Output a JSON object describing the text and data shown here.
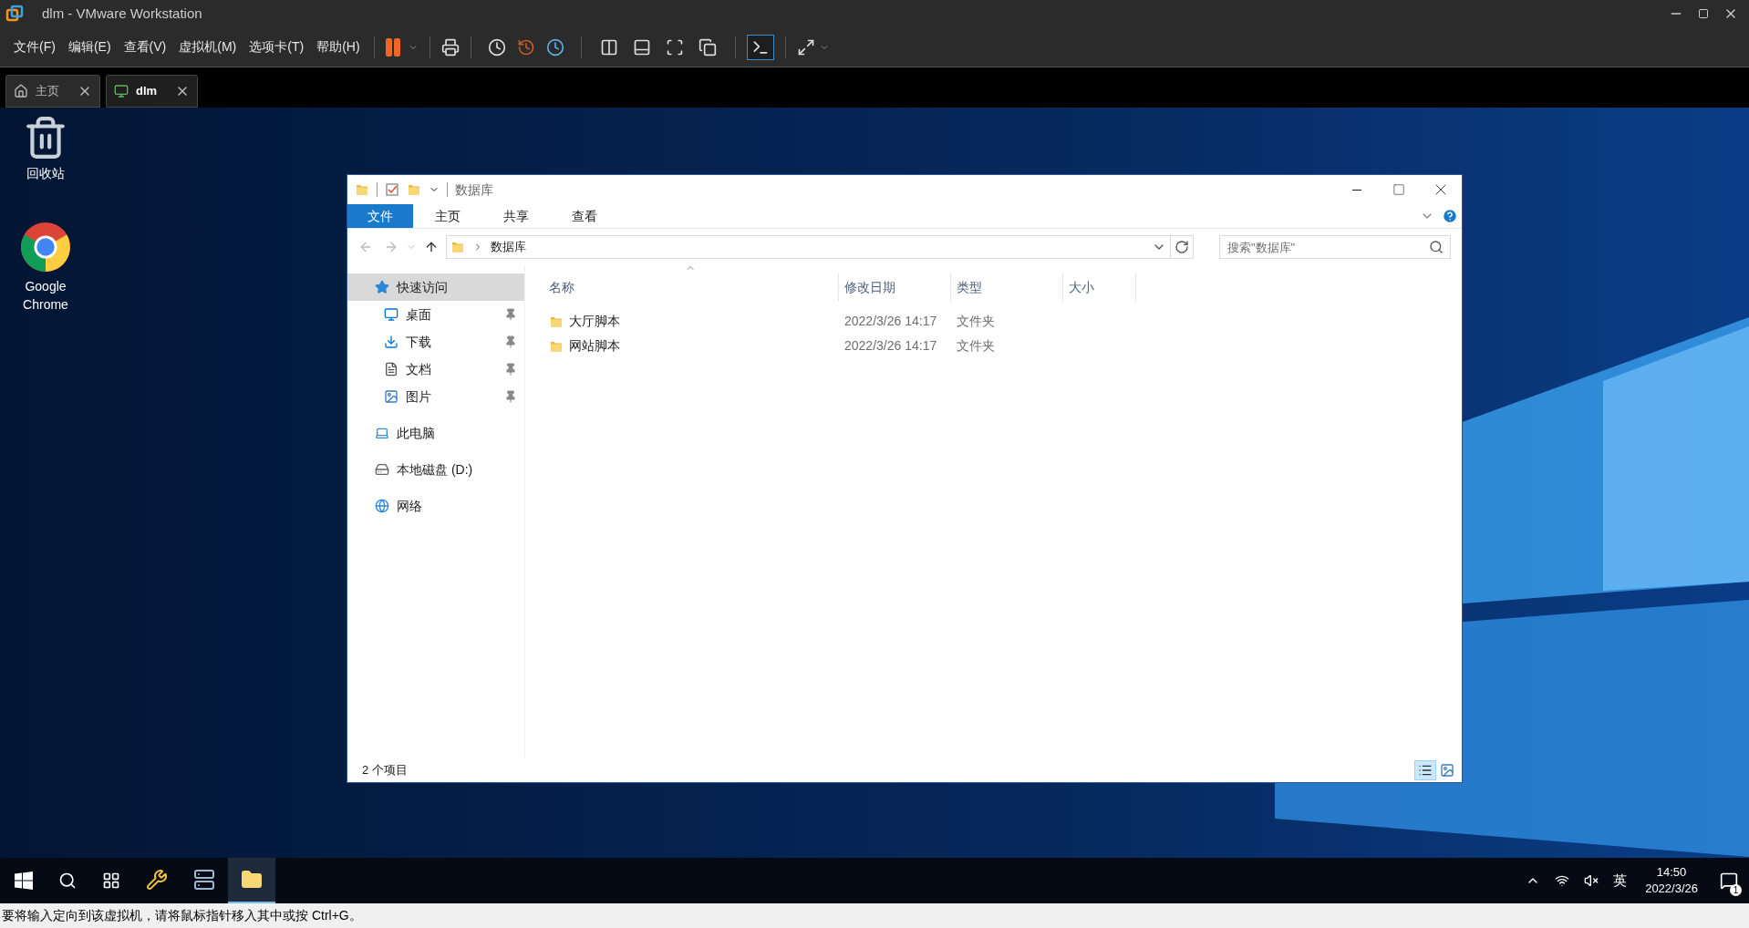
{
  "window": {
    "title": "dlm - VMware Workstation"
  },
  "menu": [
    "文件(F)",
    "编辑(E)",
    "查看(V)",
    "虚拟机(M)",
    "选项卡(T)",
    "帮助(H)"
  ],
  "vm_tabs": [
    {
      "label": "主页",
      "kind": "home",
      "selected": false
    },
    {
      "label": "dlm",
      "kind": "vm",
      "selected": true
    }
  ],
  "desktop_icons": [
    {
      "label": "回收站",
      "kind": "recycle"
    },
    {
      "label": "Google Chrome",
      "kind": "chrome"
    }
  ],
  "explorer": {
    "title": "数据库",
    "ribbon_tabs": [
      {
        "label": "文件",
        "kind": "file",
        "selected": false
      },
      {
        "label": "主页",
        "kind": "tab",
        "selected": false
      },
      {
        "label": "共享",
        "kind": "tab",
        "selected": false
      },
      {
        "label": "查看",
        "kind": "tab",
        "selected": false
      }
    ],
    "address": "数据库",
    "search": {
      "placeholder": "搜索\"数据库\""
    },
    "nav": [
      {
        "label": "快速访问",
        "kind": "star",
        "selected": true,
        "children": [
          {
            "label": "桌面",
            "kind": "desktop",
            "pinned": true
          },
          {
            "label": "下载",
            "kind": "download",
            "pinned": true
          },
          {
            "label": "文档",
            "kind": "document",
            "pinned": true
          },
          {
            "label": "图片",
            "kind": "picture",
            "pinned": true
          }
        ]
      },
      {
        "label": "此电脑",
        "kind": "pc",
        "selected": false
      },
      {
        "label": "本地磁盘 (D:)",
        "kind": "drive",
        "selected": false
      },
      {
        "label": "网络",
        "kind": "network",
        "selected": false
      }
    ],
    "columns": [
      "名称",
      "修改日期",
      "类型",
      "大小"
    ],
    "rows": [
      {
        "name": "大厅脚本",
        "modified": "2022/3/26 14:17",
        "type": "文件夹"
      },
      {
        "name": "网站脚本",
        "modified": "2022/3/26 14:17",
        "type": "文件夹"
      }
    ],
    "status": "2 个项目",
    "views": [
      {
        "kind": "details",
        "selected": true
      },
      {
        "kind": "thumbnails",
        "selected": false
      }
    ]
  },
  "taskbar": {
    "apps": [
      {
        "kind": "tools",
        "active": false
      },
      {
        "kind": "server",
        "active": false
      },
      {
        "kind": "explorer",
        "active": true
      }
    ],
    "ime": "英",
    "time": "14:50",
    "date": "2022/3/26",
    "notifications": "1"
  },
  "status_bar": "要将输入定向到该虚拟机，请将鼠标指针移入其中或按 Ctrl+G。"
}
